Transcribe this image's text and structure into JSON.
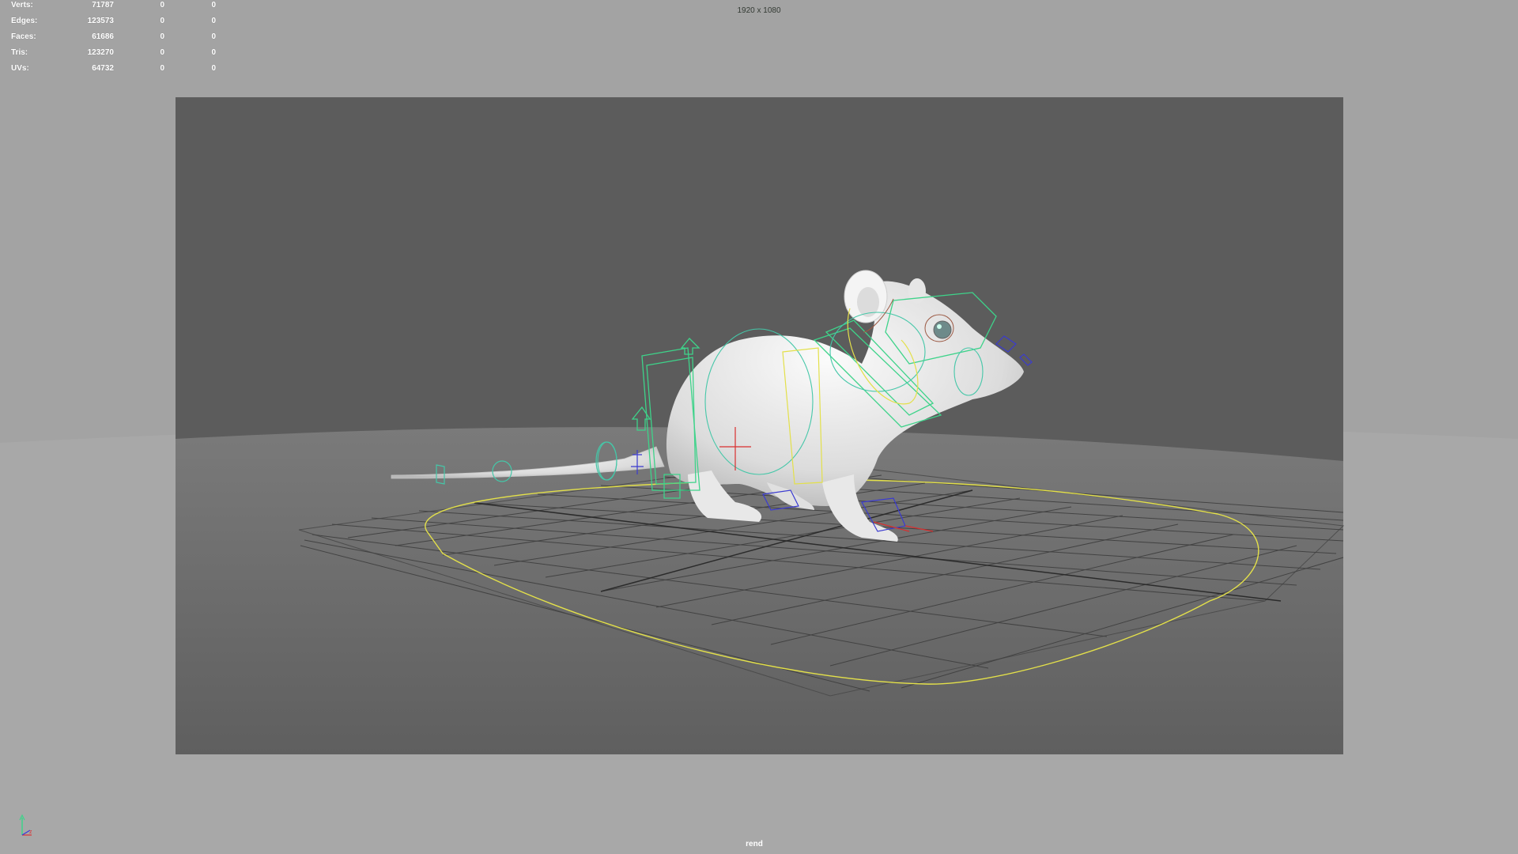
{
  "hud": {
    "rows": [
      {
        "label": "Verts:",
        "value": "71787",
        "selected": "0",
        "component": "0"
      },
      {
        "label": "Edges:",
        "value": "123573",
        "selected": "0",
        "component": "0"
      },
      {
        "label": "Faces:",
        "value": "61686",
        "selected": "0",
        "component": "0"
      },
      {
        "label": "Tris:",
        "value": "123270",
        "selected": "0",
        "component": "0"
      },
      {
        "label": "UVs:",
        "value": "64732",
        "selected": "0",
        "component": "0"
      }
    ]
  },
  "viewport": {
    "resolution_label": "1920 x 1080",
    "camera_name": "rend"
  },
  "colors": {
    "background": "#a3a3a3",
    "gate_bg": "#5c5c5c",
    "floor": "#6a6a6a",
    "grid_line": "#3f3f3f",
    "control_green": "#3ed38a",
    "control_cyan": "#45c7a8",
    "control_yellow": "#e3e04a",
    "control_blue": "#3b3bd0",
    "control_red": "#d92f2f",
    "mesh": "#ececec"
  },
  "icons": {
    "axis": "axis-indicator-icon"
  }
}
